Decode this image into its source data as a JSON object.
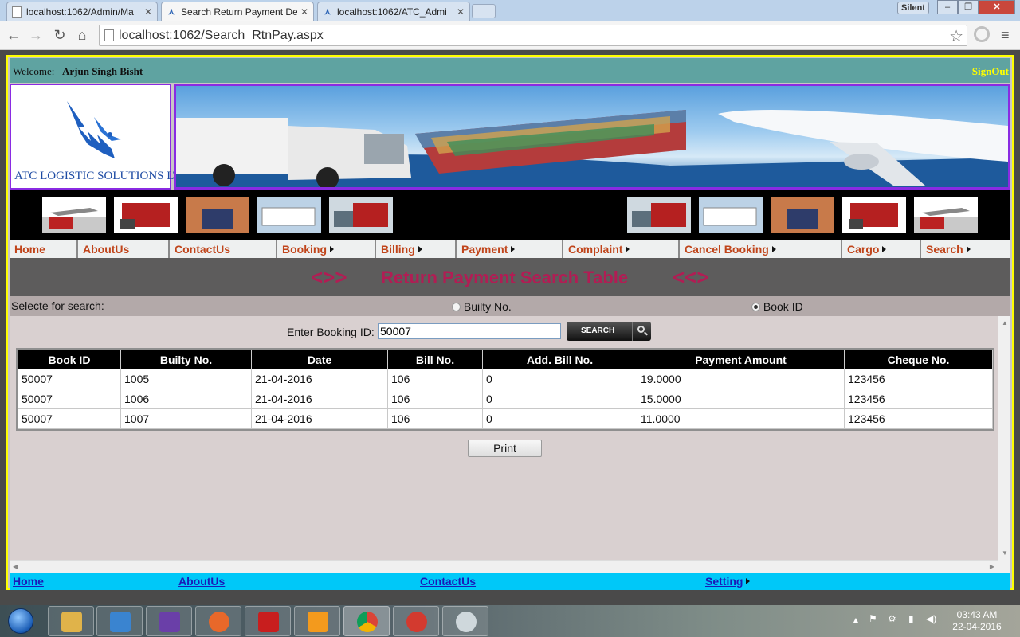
{
  "browser": {
    "tabs": [
      {
        "title": "localhost:1062/Admin/Ma",
        "active": false
      },
      {
        "title": "Search Return Payment De",
        "active": true
      },
      {
        "title": "localhost:1062/ATC_Admi",
        "active": false
      }
    ],
    "silent_label": "Silent",
    "url": "localhost:1062/Search_RtnPay.aspx"
  },
  "header": {
    "welcome_label": "Welcome:",
    "user_name": "Arjun Singh Bisht",
    "signout": "SignOut",
    "company_name": "ATC LOGISTIC SOLUTIONS LTD."
  },
  "menu": [
    {
      "label": "Home",
      "has_sub": false
    },
    {
      "label": "AboutUs",
      "has_sub": false
    },
    {
      "label": "ContactUs",
      "has_sub": false
    },
    {
      "label": "Booking",
      "has_sub": true
    },
    {
      "label": "Billing",
      "has_sub": true
    },
    {
      "label": "Payment",
      "has_sub": true
    },
    {
      "label": "Complaint",
      "has_sub": true
    },
    {
      "label": "Cancel Booking",
      "has_sub": true
    },
    {
      "label": "Cargo",
      "has_sub": true
    },
    {
      "label": "Search",
      "has_sub": true
    }
  ],
  "page_title": {
    "left_deco": "<>>",
    "text": "Return Payment Search Table",
    "right_deco": "<<>"
  },
  "search": {
    "select_label": "Selecte for search:",
    "options": [
      {
        "label": "Builty No.",
        "selected": false
      },
      {
        "label": "Book ID",
        "selected": true
      }
    ],
    "booking_label": "Enter Booking ID:",
    "booking_value": "50007",
    "button_label": "SEARCH"
  },
  "table": {
    "columns": [
      "Book ID",
      "Builty No.",
      "Date",
      "Bill No.",
      "Add. Bill No.",
      "Payment Amount",
      "Cheque No."
    ],
    "rows": [
      [
        "50007",
        "1005",
        "21-04-2016",
        "106",
        "0",
        "19.0000",
        "123456"
      ],
      [
        "50007",
        "1006",
        "21-04-2016",
        "106",
        "0",
        "15.0000",
        "123456"
      ],
      [
        "50007",
        "1007",
        "21-04-2016",
        "106",
        "0",
        "11.0000",
        "123456"
      ]
    ]
  },
  "print_label": "Print",
  "footer": [
    {
      "label": "Home",
      "has_sub": false
    },
    {
      "label": "AboutUs",
      "has_sub": false
    },
    {
      "label": "ContactUs",
      "has_sub": false
    },
    {
      "label": "Setting",
      "has_sub": true
    }
  ],
  "taskbar": {
    "time": "03:43 AM",
    "date": "22-04-2016"
  },
  "colors": {
    "menu_text": "#c0441a",
    "title_text": "#b11d54",
    "frame_border": "#ffff00",
    "welcome_bar": "#5fa3a1",
    "footer_bar": "#00c8f8"
  }
}
